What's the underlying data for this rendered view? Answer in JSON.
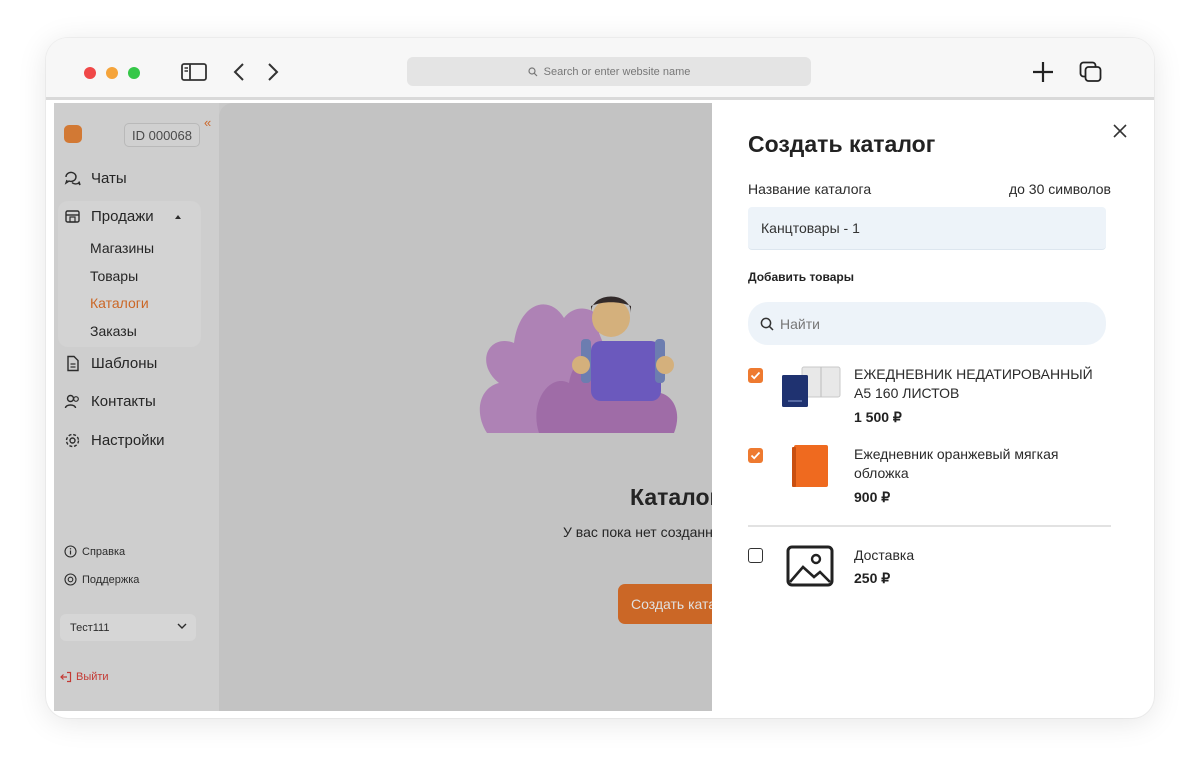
{
  "browser": {
    "address_placeholder": "Search or enter website name"
  },
  "sidebar": {
    "account_id": "ID 000068",
    "collapse_glyph": "«",
    "nav": {
      "chats": "Чаты",
      "sales": "Продажи",
      "templates": "Шаблоны",
      "contacts": "Контакты",
      "settings": "Настройки"
    },
    "sales_sub": {
      "shops": "Магазины",
      "products": "Товары",
      "catalogs": "Каталоги",
      "orders": "Заказы"
    },
    "help": "Справка",
    "support": "Поддержка",
    "workspace_select": "Тест111",
    "logout": "Выйти",
    "accent_color": "#e8762c"
  },
  "main": {
    "empty_title": "Каталоги",
    "empty_subtitle": "У вас пока нет созданных каталогов",
    "create_button": "Создать каталог"
  },
  "panel": {
    "title": "Создать каталог",
    "name_label": "Название каталога",
    "name_limit": "до 30 символов",
    "name_value": "Канцтовары - 1",
    "add_products_label": "Добавить товары",
    "search_placeholder": "Найти",
    "products": [
      {
        "name": "ЕЖЕДНЕВНИК НЕДАТИРОВАННЫЙ А5 160 ЛИСТОВ",
        "price": "1 500 ₽",
        "checked": true,
        "icon": "notebook-image"
      },
      {
        "name": "Ежедневник оранжевый мягкая обложка",
        "price": "900 ₽",
        "checked": true,
        "icon": "orange-notebook-image"
      },
      {
        "name": "Доставка",
        "price": "250 ₽",
        "checked": false,
        "icon": "image-placeholder-icon"
      }
    ]
  }
}
